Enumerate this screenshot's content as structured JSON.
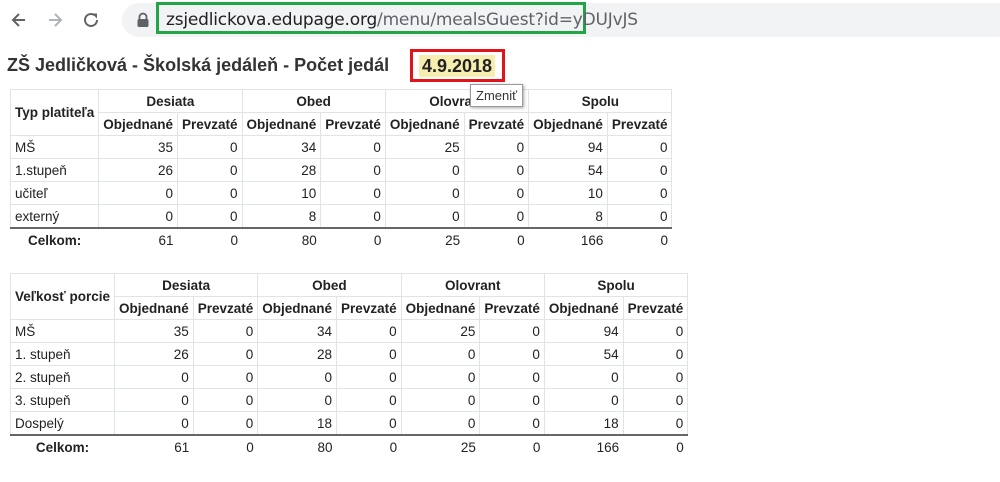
{
  "browser": {
    "url_host": "zsjedlickova.edupage.org",
    "url_path": "/menu/mealsGuest?id=yDUJvJS"
  },
  "page": {
    "title": "ZŠ Jedličková - Školská jedáleň - Počet jedál",
    "date": "4.9.2018",
    "tooltip": "Zmeniť"
  },
  "table1": {
    "row_header": "Typ platiteľa",
    "groups": [
      "Desiata",
      "Obed",
      "Olovrant",
      "Spolu"
    ],
    "subheaders": [
      "Objednané",
      "Prevzaté"
    ],
    "rows": [
      {
        "label": "MŠ",
        "values": [
          "35",
          "0",
          "34",
          "0",
          "25",
          "0",
          "94",
          "0"
        ]
      },
      {
        "label": "1.stupeň",
        "values": [
          "26",
          "0",
          "28",
          "0",
          "0",
          "0",
          "54",
          "0"
        ]
      },
      {
        "label": "učiteľ",
        "values": [
          "0",
          "0",
          "10",
          "0",
          "0",
          "0",
          "10",
          "0"
        ]
      },
      {
        "label": "externý",
        "values": [
          "0",
          "0",
          "8",
          "0",
          "0",
          "0",
          "8",
          "0"
        ]
      }
    ],
    "total": {
      "label": "Celkom:",
      "values": [
        "61",
        "0",
        "80",
        "0",
        "25",
        "0",
        "166",
        "0"
      ]
    }
  },
  "table2": {
    "row_header": "Veľkosť porcie",
    "groups": [
      "Desiata",
      "Obed",
      "Olovrant",
      "Spolu"
    ],
    "subheaders": [
      "Objednané",
      "Prevzaté"
    ],
    "rows": [
      {
        "label": "MŠ",
        "values": [
          "35",
          "0",
          "34",
          "0",
          "25",
          "0",
          "94",
          "0"
        ]
      },
      {
        "label": "1. stupeň",
        "values": [
          "26",
          "0",
          "28",
          "0",
          "0",
          "0",
          "54",
          "0"
        ]
      },
      {
        "label": "2. stupeň",
        "values": [
          "0",
          "0",
          "0",
          "0",
          "0",
          "0",
          "0",
          "0"
        ]
      },
      {
        "label": "3. stupeň",
        "values": [
          "0",
          "0",
          "0",
          "0",
          "0",
          "0",
          "0",
          "0"
        ]
      },
      {
        "label": "Dospelý",
        "values": [
          "0",
          "0",
          "18",
          "0",
          "0",
          "0",
          "18",
          "0"
        ]
      }
    ],
    "total": {
      "label": "Celkom:",
      "values": [
        "61",
        "0",
        "80",
        "0",
        "25",
        "0",
        "166",
        "0"
      ]
    }
  },
  "icons": {
    "back": "back-arrow-icon",
    "forward": "forward-arrow-icon",
    "reload": "reload-icon",
    "lock": "lock-icon"
  },
  "colors": {
    "url_highlight": "#22a546",
    "date_highlight": "#e3131b",
    "date_background": "#f6eeaf"
  }
}
